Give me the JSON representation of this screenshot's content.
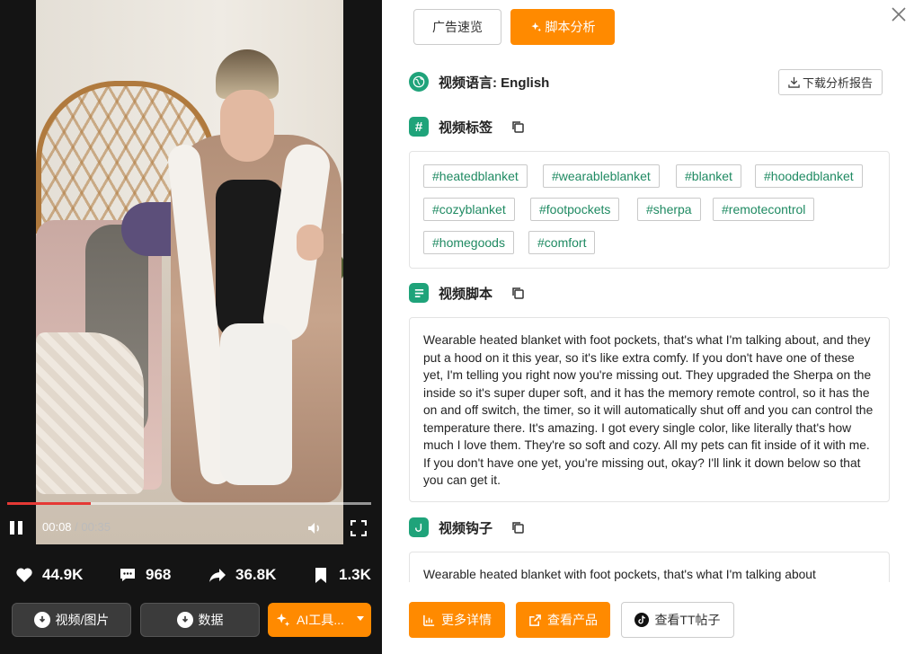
{
  "player": {
    "time_current": "00:08",
    "time_separator": " / ",
    "time_duration": "00:35",
    "progress": 0.23
  },
  "stats": {
    "likes": "44.9K",
    "comments": "968",
    "shares": "36.8K",
    "saves": "1.3K"
  },
  "left_actions": {
    "video_image": "视频/图片",
    "data": "数据",
    "ai_tools": "AI工具..."
  },
  "tabs": {
    "preview": "广告速览",
    "script": "脚本分析"
  },
  "language": {
    "label": "视频语言:",
    "value": "English",
    "download": "下载分析报告"
  },
  "tags": {
    "title": "视频标签",
    "items": [
      "#heatedblanket",
      "#wearableblanket",
      "#blanket",
      "#hoodedblanket",
      "#cozyblanket",
      "#footpockets",
      "#sherpa",
      "#remotecontrol",
      "#homegoods",
      "#comfort"
    ]
  },
  "script": {
    "title": "视频脚本",
    "text": "Wearable heated blanket with foot pockets, that's what I'm talking about, and they put a hood on it this year, so it's like extra comfy. If you don't have one of these yet, I'm telling you right now you're missing out. They upgraded the Sherpa on the inside so it's super duper soft, and it has the memory remote control, so it has the on and off switch, the timer, so it will automatically shut off and you can control the temperature there. It's amazing. I got every single color, like literally that's how much I love them. They're so soft and cozy. All my pets can fit inside of it with me. If you don't have one yet, you're missing out, okay? I'll link it down below so that you can get it."
  },
  "hook": {
    "title": "视频钩子",
    "text": "Wearable heated blanket with foot pockets, that's what I'm talking about"
  },
  "bottom_actions": {
    "more_details": "更多详情",
    "view_product": "查看产品",
    "view_tt_post": "查看TT帖子"
  },
  "colors": {
    "accent": "#ff8a00",
    "section_icon": "#1fa37a",
    "tag_text": "#1f8a62",
    "progress": "#e53935"
  }
}
